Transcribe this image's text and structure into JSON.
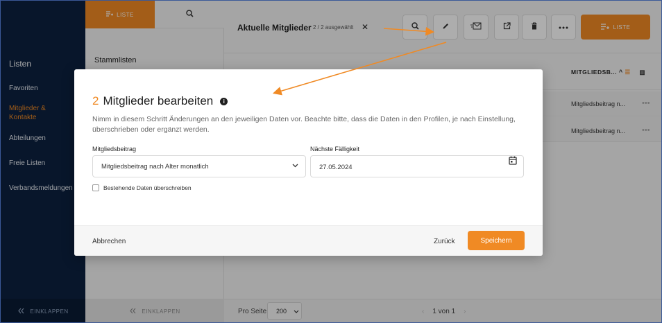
{
  "nav": {
    "section_title": "Listen",
    "items": [
      {
        "label": "Favoriten"
      },
      {
        "label": "Mitglieder & Kontakte"
      },
      {
        "label": "Abteilungen"
      },
      {
        "label": "Freie Listen"
      },
      {
        "label": "Verbandsmeldungen"
      }
    ],
    "collapse_label": "EINKLAPPEN"
  },
  "col2": {
    "tab_list_label": "LISTE",
    "heading": "Stammlisten",
    "collapse_label": "EINKLAPPEN"
  },
  "main": {
    "title": "Aktuelle Mitglieder",
    "selection_count": "2 / 2 ausgewählt",
    "list_button_label": "LISTE",
    "column_header": "MITGLIEDSB...",
    "rows": [
      {
        "value": "Mitgliedsbeitrag n..."
      },
      {
        "value": "Mitgliedsbeitrag n..."
      }
    ],
    "footer": {
      "per_page_label": "Pro Seite",
      "per_page_value": "200",
      "page_info": "1 von 1"
    }
  },
  "modal": {
    "count": "2",
    "title": "Mitglieder bearbeiten",
    "description": "Nimm in diesem Schritt Änderungen an den jeweiligen Daten vor. Beachte bitte, dass die Daten in den Profilen, je nach Einstellung, überschrieben oder ergänzt werden.",
    "fee_label": "Mitgliedsbeitrag",
    "fee_value": "Mitgliedsbeitrag nach Alter monatlich",
    "due_label": "Nächste Fälligkeit",
    "due_value": "27.05.2024",
    "overwrite_label": "Bestehende Daten überschreiben",
    "cancel_label": "Abbrechen",
    "back_label": "Zurück",
    "save_label": "Speichern"
  },
  "colors": {
    "accent": "#f08a24",
    "nav_bg": "#0c2140",
    "arrow": "#f08a24"
  }
}
